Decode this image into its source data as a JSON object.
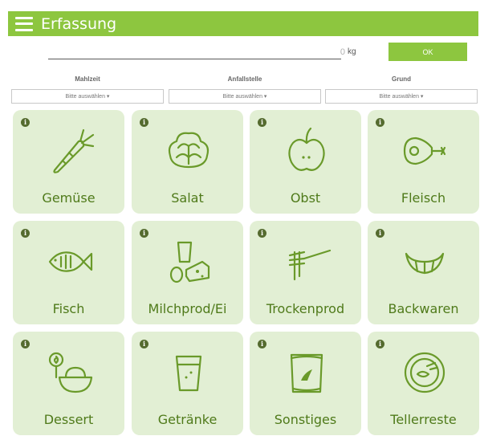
{
  "header": {
    "title": "Erfassung"
  },
  "weight": {
    "value": "0",
    "unit": "kg"
  },
  "ok_label": "OK",
  "filters": [
    {
      "label": "Mahlzeit",
      "select": "Bitte auswählen ▾"
    },
    {
      "label": "Anfallstelle",
      "select": "Bitte auswählen ▾"
    },
    {
      "label": "Grund",
      "select": "Bitte auswählen ▾"
    }
  ],
  "info_glyph": "i",
  "tiles": [
    {
      "label": "Gemüse",
      "icon": "carrot-icon"
    },
    {
      "label": "Salat",
      "icon": "lettuce-icon"
    },
    {
      "label": "Obst",
      "icon": "apple-icon"
    },
    {
      "label": "Fleisch",
      "icon": "ham-icon"
    },
    {
      "label": "Fisch",
      "icon": "fish-icon"
    },
    {
      "label": "Milchprod/Ei",
      "icon": "dairy-egg-icon"
    },
    {
      "label": "Trockenprod",
      "icon": "pasta-fork-icon"
    },
    {
      "label": "Backwaren",
      "icon": "croissant-icon"
    },
    {
      "label": "Dessert",
      "icon": "dessert-icon"
    },
    {
      "label": "Getränke",
      "icon": "glass-icon"
    },
    {
      "label": "Sonstiges",
      "icon": "package-icon"
    },
    {
      "label": "Tellerreste",
      "icon": "plate-waste-icon"
    }
  ],
  "colors": {
    "accent": "#8dc63f",
    "tile_bg": "#e2efd4",
    "label": "#4f7a1a",
    "info": "#556b2f"
  }
}
